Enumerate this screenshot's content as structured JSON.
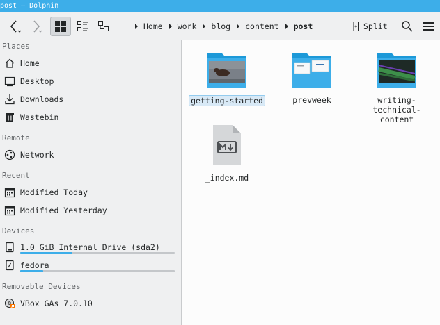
{
  "window": {
    "title": "post — Dolphin"
  },
  "toolbar": {
    "split_label": "Split"
  },
  "breadcrumbs": [
    "Home",
    "work",
    "blog",
    "content",
    "post"
  ],
  "sidebar": {
    "sections": [
      {
        "title": "Places",
        "items": [
          {
            "label": "Home",
            "icon": "home-icon"
          },
          {
            "label": "Desktop",
            "icon": "desktop-icon"
          },
          {
            "label": "Downloads",
            "icon": "download-icon"
          },
          {
            "label": "Wastebin",
            "icon": "trash-icon"
          }
        ]
      },
      {
        "title": "Remote",
        "items": [
          {
            "label": "Network",
            "icon": "network-icon"
          }
        ]
      },
      {
        "title": "Recent",
        "items": [
          {
            "label": "Modified Today",
            "icon": "calendar-icon"
          },
          {
            "label": "Modified Yesterday",
            "icon": "calendar-icon"
          }
        ]
      },
      {
        "title": "Devices",
        "items": [
          {
            "label": "1.0 GiB Internal Drive (sda2)",
            "icon": "drive-icon",
            "usage": 0.34
          },
          {
            "label": "fedora",
            "icon": "drive-icon",
            "usage": 0.15
          }
        ]
      },
      {
        "title": "Removable Devices",
        "items": [
          {
            "label": "VBox_GAs_7.0.10",
            "icon": "optical-disc-icon"
          }
        ]
      }
    ]
  },
  "files": [
    {
      "name": "getting-started",
      "type": "folder",
      "selected": true
    },
    {
      "name": "prevweek",
      "type": "folder",
      "selected": false
    },
    {
      "name": "writing-\ntechnical-content",
      "type": "folder",
      "selected": false
    },
    {
      "name": "_index.md",
      "type": "markdown",
      "selected": false
    }
  ],
  "colors": {
    "accent": "#3daee9",
    "folder": "#3daee9",
    "folder_dark": "#1d99d8"
  }
}
